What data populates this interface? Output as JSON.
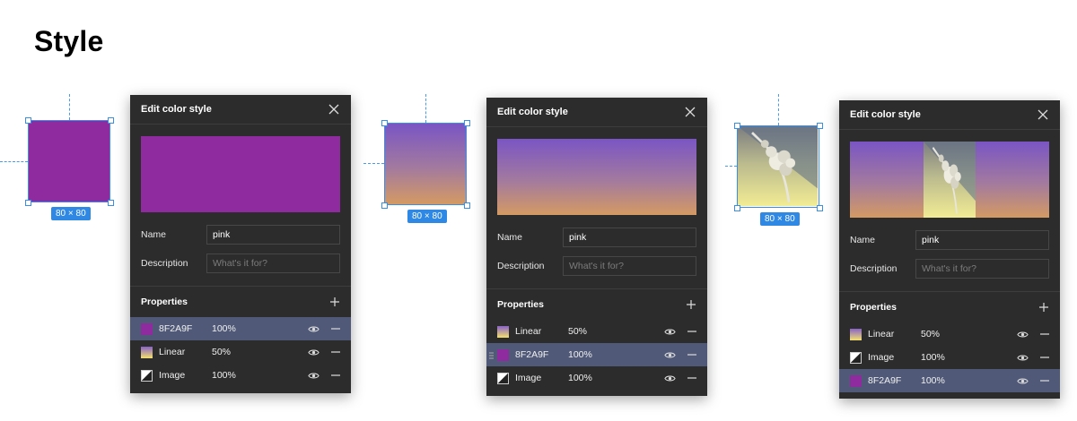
{
  "page": {
    "title": "Style"
  },
  "colors": {
    "purple": "#8F2A9F",
    "panel_bg": "#2c2c2c",
    "selection": "#3b8ee6",
    "row_selected": "#505a78"
  },
  "sections": [
    {
      "canvas": {
        "dimension_label": "80 × 80",
        "fill": "solid"
      },
      "panel": {
        "title": "Edit color style",
        "preview": "solid",
        "name_label": "Name",
        "name_value": "pink",
        "description_label": "Description",
        "description_placeholder": "What's it for?",
        "properties_label": "Properties",
        "properties": [
          {
            "name": "8F2A9F",
            "opacity": "100%",
            "swatch": "solid",
            "selected": true
          },
          {
            "name": "Linear",
            "opacity": "50%",
            "swatch": "linear",
            "selected": false
          },
          {
            "name": "Image",
            "opacity": "100%",
            "swatch": "image",
            "selected": false
          }
        ]
      }
    },
    {
      "canvas": {
        "dimension_label": "80 × 80",
        "fill": "gradient"
      },
      "panel": {
        "title": "Edit color style",
        "preview": "gradient",
        "name_label": "Name",
        "name_value": "pink",
        "description_label": "Description",
        "description_placeholder": "What's it for?",
        "properties_label": "Properties",
        "properties": [
          {
            "name": "Linear",
            "opacity": "50%",
            "swatch": "linear",
            "selected": false
          },
          {
            "name": "8F2A9F",
            "opacity": "100%",
            "swatch": "solid",
            "selected": true,
            "dragging": true
          },
          {
            "name": "Image",
            "opacity": "100%",
            "swatch": "image",
            "selected": false
          }
        ]
      }
    },
    {
      "canvas": {
        "dimension_label": "80 × 80",
        "fill": "image"
      },
      "panel": {
        "title": "Edit color style",
        "preview": "mixed",
        "name_label": "Name",
        "name_value": "pink",
        "description_label": "Description",
        "description_placeholder": "What's it for?",
        "properties_label": "Properties",
        "properties": [
          {
            "name": "Linear",
            "opacity": "50%",
            "swatch": "linear",
            "selected": false
          },
          {
            "name": "Image",
            "opacity": "100%",
            "swatch": "image",
            "selected": false
          },
          {
            "name": "8F2A9F",
            "opacity": "100%",
            "swatch": "solid",
            "selected": true
          }
        ]
      }
    }
  ]
}
